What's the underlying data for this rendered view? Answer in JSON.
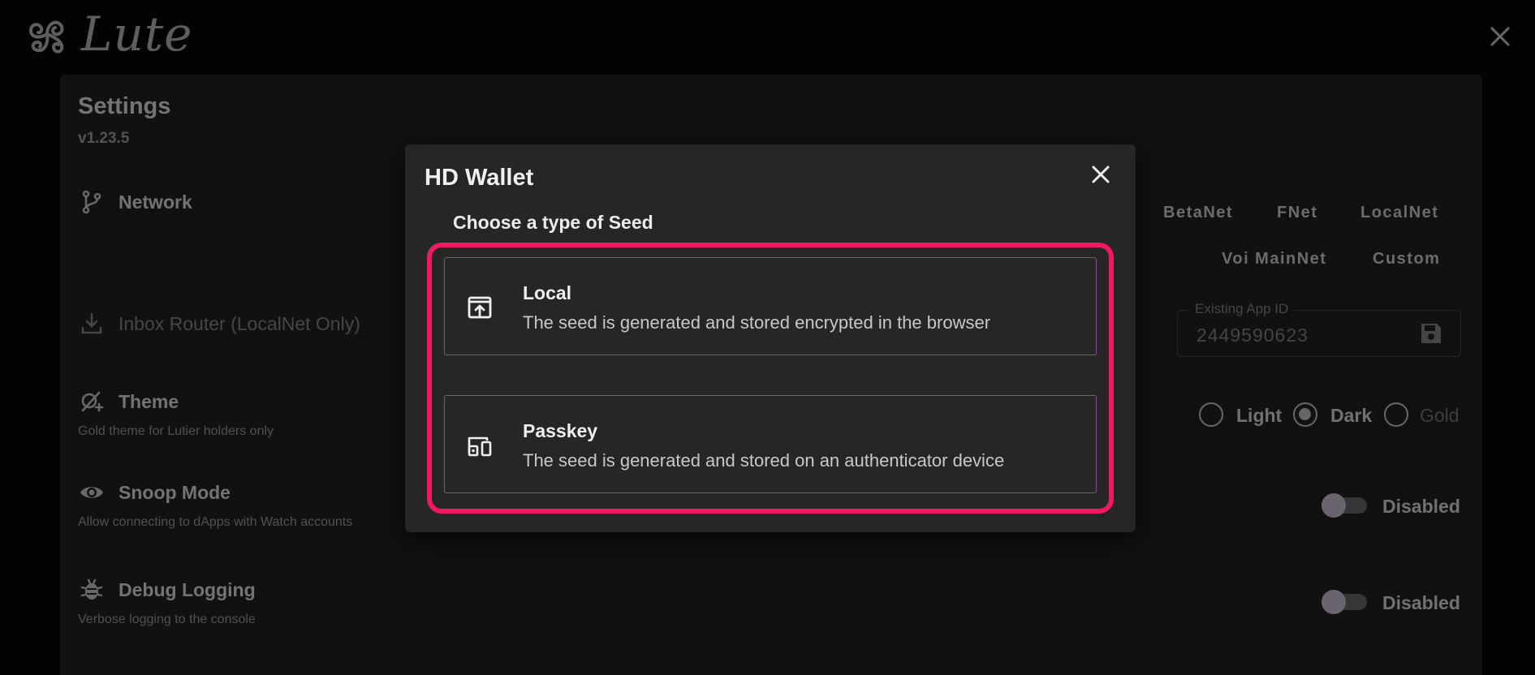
{
  "app": {
    "name": "Lute"
  },
  "settings": {
    "title": "Settings",
    "version": "v1.23.5",
    "network": {
      "label": "Network",
      "options": [
        "BetaNet",
        "FNet",
        "LocalNet",
        "Voi MainNet",
        "Custom"
      ]
    },
    "inbox_router": {
      "label": "Inbox Router (LocalNet Only)",
      "field_label": "Existing App ID",
      "field_value": "2449590623"
    },
    "theme": {
      "label": "Theme",
      "subtitle": "Gold theme for Lutier holders only",
      "options": [
        "Light",
        "Dark",
        "Gold"
      ],
      "selected": "Dark"
    },
    "snoop_mode": {
      "label": "Snoop Mode",
      "subtitle": "Allow connecting to dApps with Watch accounts",
      "status": "Disabled"
    },
    "debug_logging": {
      "label": "Debug Logging",
      "subtitle": "Verbose logging to the console",
      "status": "Disabled"
    }
  },
  "dialog": {
    "title": "HD Wallet",
    "subtitle": "Choose a type of Seed",
    "options": [
      {
        "title": "Local",
        "description": "The seed is generated and stored encrypted in the browser",
        "icon": "upload-box-icon"
      },
      {
        "title": "Passkey",
        "description": "The seed is generated and stored on an authenticator device",
        "icon": "devices-icon"
      }
    ],
    "highlight_color": "#f0195f"
  }
}
